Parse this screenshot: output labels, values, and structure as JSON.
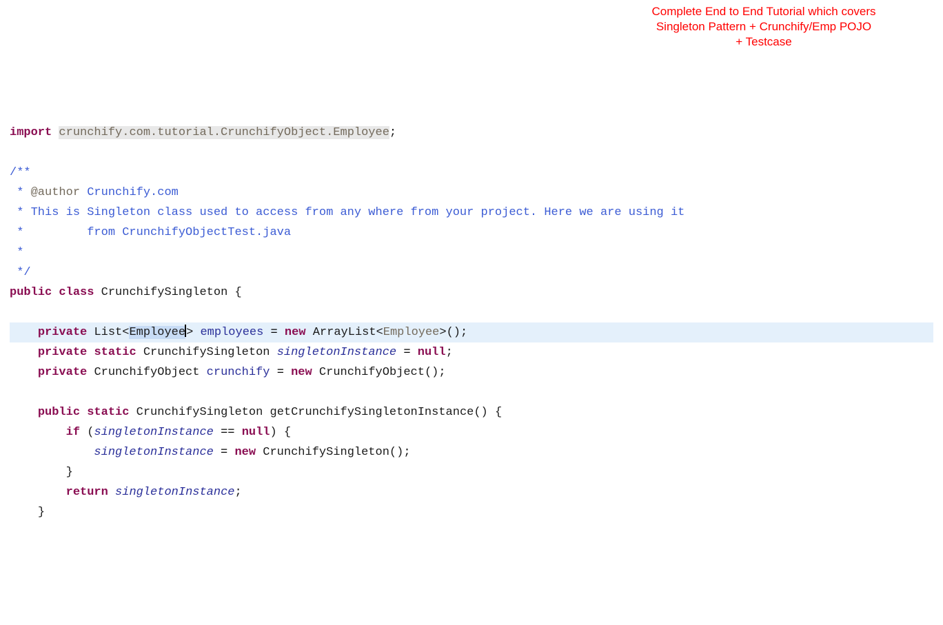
{
  "callout": {
    "line1": "Complete End to End Tutorial which covers",
    "line2": "Singleton Pattern + Crunchify/Emp POJO",
    "line3": "+ Testcase"
  },
  "code": {
    "l1": {
      "import": "import",
      "pkg": "crunchify.com.tutorial.CrunchifyObject.Employee",
      "semi": ";"
    },
    "l3": "/**",
    "l4a": " * ",
    "l4_tag": "@author",
    "l4b": " Crunchify.com",
    "l5": " * This is Singleton class used to access from any where from your project. Here we are using it",
    "l6": " *         from CrunchifyObjectTest.java",
    "l7": " *",
    "l8": " */",
    "l9": {
      "public": "public",
      "class": "class",
      "name": "CrunchifySingleton",
      "brace": "{"
    },
    "l11": {
      "indent": "    ",
      "private": "private",
      "sp": " ",
      "list": "List",
      "lt": "<",
      "emp": "Employee",
      "gt": ">",
      "field": "employees",
      "eq": " = ",
      "new": "new",
      "al": "ArrayList",
      "lt2": "<",
      "emp2": "Employee",
      "gt2": ">",
      "call": "();"
    },
    "l12": {
      "indent": "    ",
      "private": "private",
      "static": "static",
      "type": "CrunchifySingleton",
      "field": "singletonInstance",
      "eq": " = ",
      "null": "null",
      "semi": ";"
    },
    "l13": {
      "indent": "    ",
      "private": "private",
      "type": "CrunchifyObject",
      "field": "crunchify",
      "eq": " = ",
      "new": "new",
      "ctor": "CrunchifyObject",
      "call": "();"
    },
    "l15": {
      "indent": "    ",
      "public": "public",
      "static": "static",
      "ret": "CrunchifySingleton",
      "name": "getCrunchifySingletonInstance",
      "paren": "() {"
    },
    "l16": {
      "indent": "        ",
      "if": "if",
      "lp": " (",
      "var": "singletonInstance",
      "cmp": " == ",
      "null": "null",
      "rp": ") {"
    },
    "l17": {
      "indent": "            ",
      "var": "singletonInstance",
      "eq": " = ",
      "new": "new",
      "ctor": "CrunchifySingleton",
      "call": "();"
    },
    "l18": {
      "indent": "        ",
      "brace": "}"
    },
    "l19": {
      "indent": "        ",
      "return": "return",
      "sp": " ",
      "var": "singletonInstance",
      "semi": ";"
    },
    "l20": {
      "indent": "    ",
      "brace": "}"
    }
  }
}
